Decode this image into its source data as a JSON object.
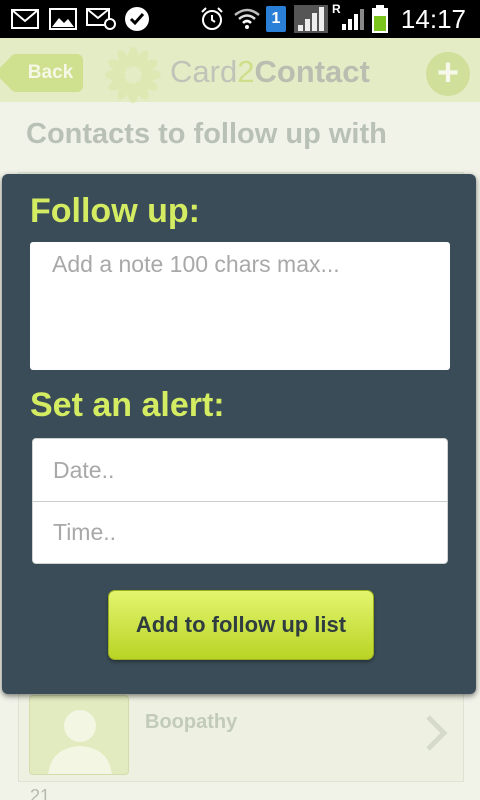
{
  "status_bar": {
    "time": "14:17",
    "sim_slot": "1",
    "roaming_indicator": "R",
    "icons": [
      "email-icon",
      "gallery-icon",
      "email-alert-icon",
      "check-app-icon",
      "alarm-icon",
      "wifi-icon",
      "sim-icon",
      "signal-icon",
      "battery-icon"
    ]
  },
  "app_bar": {
    "back_label": "Back",
    "logo_part1": "Card",
    "logo_part2": "2",
    "logo_part3": "Contact",
    "add_label": "+"
  },
  "page": {
    "title": "Contacts to follow up with"
  },
  "dialog": {
    "follow_up_title": "Follow up:",
    "note_placeholder": "Add a note 100 chars max...",
    "alert_title": "Set an alert:",
    "date_placeholder": "Date..",
    "time_placeholder": "Time..",
    "add_button_label": "Add to follow up list"
  },
  "contacts": [
    {
      "name": "Boopathy"
    }
  ],
  "list_partial_number": "21",
  "colors": {
    "accent": "#d4ec62",
    "dialog_bg": "#3a4c57",
    "button_top": "#e3f56e",
    "button_bottom": "#b9d425"
  }
}
